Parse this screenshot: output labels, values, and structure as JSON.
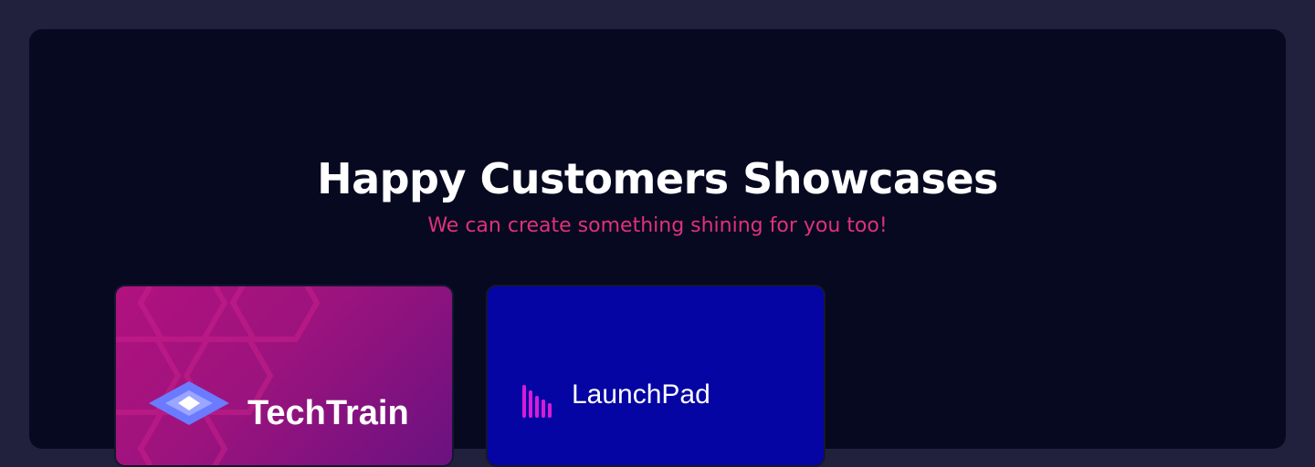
{
  "header": {
    "title": "Happy Customers Showcases",
    "subtitle": "We can create something shining for you too!"
  },
  "showcases": [
    {
      "name": "TechTrain",
      "logo_icon": "cube-logo-icon"
    },
    {
      "name": "LaunchPad",
      "logo_icon": "bars-logo-icon"
    }
  ],
  "colors": {
    "page_background": "#21213e",
    "panel_background": "#060920",
    "subtitle_accent": "#e0317a",
    "card_1_gradient_start": "#b1127e",
    "card_1_gradient_end": "#6a1280",
    "card_2_background": "#0505a3",
    "bars_logo": "#d81bd8"
  }
}
